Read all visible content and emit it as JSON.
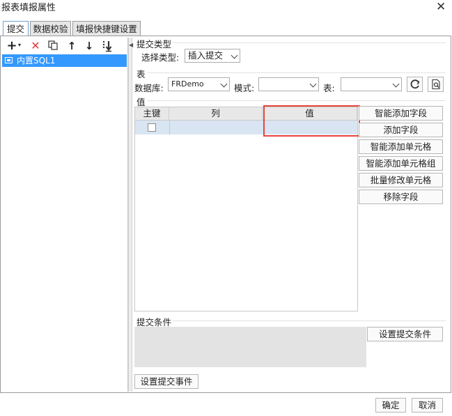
{
  "window": {
    "title": "报表填报属性",
    "close_glyph": "✕"
  },
  "tabs": [
    {
      "label": "提交",
      "active": true
    },
    {
      "label": "数据校验",
      "active": false
    },
    {
      "label": "填报快捷键设置",
      "active": false
    }
  ],
  "toolbar": {
    "add_glyph": "+",
    "add_arrow": "▾",
    "delete_glyph": "✕",
    "up_glyph": "↑",
    "down_glyph": "↓"
  },
  "tree": {
    "items": [
      {
        "label": "内置SQL1",
        "selected": true
      }
    ]
  },
  "submit_type": {
    "section": "提交类型",
    "label": "选择类型:",
    "value": "插入提交"
  },
  "table_section": {
    "section": "表",
    "database_label": "数据库:",
    "database_value": "FRDemo",
    "schema_label": "模式:",
    "schema_value": "",
    "table_label": "表:",
    "table_value": ""
  },
  "value_section": {
    "section": "值",
    "columns": [
      "主键",
      "列",
      "值"
    ],
    "buttons": [
      "智能添加字段",
      "添加字段",
      "智能添加单元格",
      "智能添加单元格组",
      "批量修改单元格",
      "移除字段"
    ]
  },
  "condition": {
    "section": "提交条件",
    "button": "设置提交条件"
  },
  "event_button": "设置提交事件",
  "footer": {
    "ok": "确定",
    "cancel": "取消"
  },
  "colors": {
    "selection": "#3399ff",
    "highlight": "#e8433a",
    "delete": "#e03a3a"
  }
}
